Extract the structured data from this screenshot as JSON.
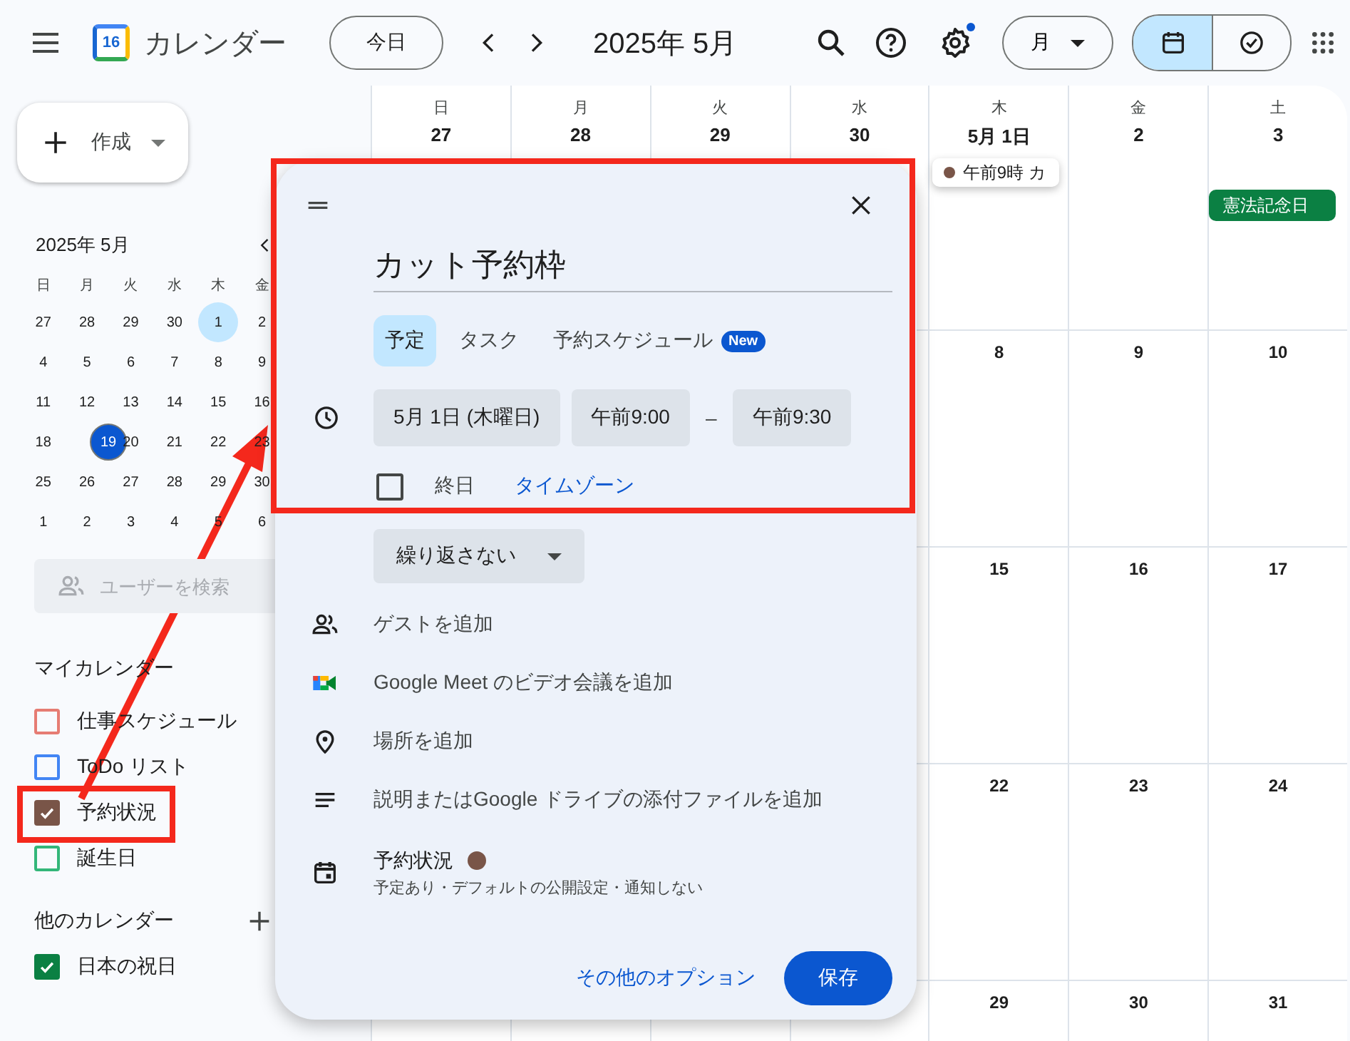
{
  "header": {
    "app_name": "カレンダー",
    "logo_text": "16",
    "today_button": "今日",
    "period": "2025年 5月",
    "settings_badge": true,
    "view_select": "月",
    "views": [
      {
        "kind": "calendar",
        "selected": true
      },
      {
        "kind": "tasks",
        "selected": false
      }
    ]
  },
  "sidebar": {
    "create_button": "作成",
    "mini_calendar": {
      "title": "2025年 5月",
      "weekdays": [
        "日",
        "月",
        "火",
        "水",
        "木",
        "金"
      ],
      "weeks": [
        [
          {
            "day": "27",
            "selected": false,
            "today": false
          },
          {
            "day": "28",
            "selected": false,
            "today": false
          },
          {
            "day": "29",
            "selected": false,
            "today": false
          },
          {
            "day": "30",
            "selected": false,
            "today": false
          },
          {
            "day": "1",
            "selected": true,
            "today": false
          },
          {
            "day": "2",
            "selected": false,
            "today": false
          }
        ],
        [
          {
            "day": "4",
            "selected": false,
            "today": false
          },
          {
            "day": "5",
            "selected": false,
            "today": false
          },
          {
            "day": "6",
            "selected": false,
            "today": false
          },
          {
            "day": "7",
            "selected": false,
            "today": false
          },
          {
            "day": "8",
            "selected": false,
            "today": false
          },
          {
            "day": "9",
            "selected": false,
            "today": false
          }
        ],
        [
          {
            "day": "11",
            "selected": false,
            "today": false
          },
          {
            "day": "12",
            "selected": false,
            "today": false
          },
          {
            "day": "13",
            "selected": false,
            "today": false
          },
          {
            "day": "14",
            "selected": false,
            "today": false
          },
          {
            "day": "15",
            "selected": false,
            "today": false
          },
          {
            "day": "16",
            "selected": false,
            "today": false
          }
        ],
        [
          {
            "day": "18",
            "selected": false,
            "today": false
          },
          {
            "day": "19",
            "selected": false,
            "today": true
          },
          {
            "day": "20",
            "selected": false,
            "today": false
          },
          {
            "day": "21",
            "selected": false,
            "today": false
          },
          {
            "day": "22",
            "selected": false,
            "today": false
          },
          {
            "day": "23",
            "selected": false,
            "today": false
          }
        ],
        [
          {
            "day": "25",
            "selected": false,
            "today": false
          },
          {
            "day": "26",
            "selected": false,
            "today": false
          },
          {
            "day": "27",
            "selected": false,
            "today": false
          },
          {
            "day": "28",
            "selected": false,
            "today": false
          },
          {
            "day": "29",
            "selected": false,
            "today": false
          },
          {
            "day": "30",
            "selected": false,
            "today": false
          }
        ],
        [
          {
            "day": "1",
            "selected": false,
            "today": false
          },
          {
            "day": "2",
            "selected": false,
            "today": false
          },
          {
            "day": "3",
            "selected": false,
            "today": false
          },
          {
            "day": "4",
            "selected": false,
            "today": false
          },
          {
            "day": "5",
            "selected": false,
            "today": false
          },
          {
            "day": "6",
            "selected": false,
            "today": false
          }
        ]
      ]
    },
    "people_search": {
      "placeholder": "ユーザーを検索"
    },
    "my_calendars": {
      "title": "マイカレンダー",
      "items": [
        {
          "label": "仕事スケジュール",
          "color": "#e67c73",
          "checked": false
        },
        {
          "label": "ToDo リスト",
          "color": "#4285f4",
          "checked": false
        },
        {
          "label": "予約状況",
          "color": "#795548",
          "checked": true
        },
        {
          "label": "誕生日",
          "color": "#33b679",
          "checked": false
        }
      ]
    },
    "other_calendars": {
      "title": "他のカレンダー",
      "items": [
        {
          "label": "日本の祝日",
          "color": "#0b8043",
          "checked": true
        }
      ]
    }
  },
  "month_grid": {
    "weekdays": [
      "日",
      "月",
      "火",
      "水",
      "木",
      "金",
      "土"
    ],
    "first_week": [
      {
        "day": "27"
      },
      {
        "day": "28"
      },
      {
        "day": "29"
      },
      {
        "day": "30"
      },
      {
        "day": "5月 1日",
        "events": [
          {
            "kind": "timed",
            "text": "午前9時 カ",
            "color": "#795548"
          }
        ]
      },
      {
        "day": "2"
      },
      {
        "day": "3",
        "events": [
          {
            "kind": "allday",
            "text": "憲法記念日",
            "color": "#0b8043"
          }
        ]
      }
    ],
    "later_weeks_visible_days": [
      [
        "8",
        "9",
        "10"
      ],
      [
        "15",
        "16",
        "17"
      ],
      [
        "22",
        "23",
        "24"
      ],
      [
        "29",
        "30",
        "31"
      ]
    ]
  },
  "dialog": {
    "title_value": "カット予約枠",
    "types": [
      {
        "label": "予定",
        "selected": true
      },
      {
        "label": "タスク",
        "selected": false
      },
      {
        "label": "予約スケジュール",
        "selected": false,
        "badge": "New"
      }
    ],
    "date": "5月 1日 (木曜日)",
    "start": "午前9:00",
    "separator": "–",
    "end": "午前9:30",
    "all_day": {
      "label": "終日",
      "checked": false
    },
    "timezone_link": "タイムゾーン",
    "repeat": "繰り返さない",
    "rows": [
      {
        "kind": "guests",
        "text": "ゲストを追加"
      },
      {
        "kind": "meet",
        "text": "Google Meet のビデオ会議を追加"
      },
      {
        "kind": "location",
        "text": "場所を追加"
      },
      {
        "kind": "description",
        "text": "説明またはGoogle ドライブの添付ファイルを追加"
      },
      {
        "kind": "calendar",
        "text": "予約状況",
        "color": "#795548",
        "detail": "予定あり・デフォルトの公開設定・通知しない"
      }
    ],
    "more_options": "その他のオプション",
    "save": "保存"
  }
}
